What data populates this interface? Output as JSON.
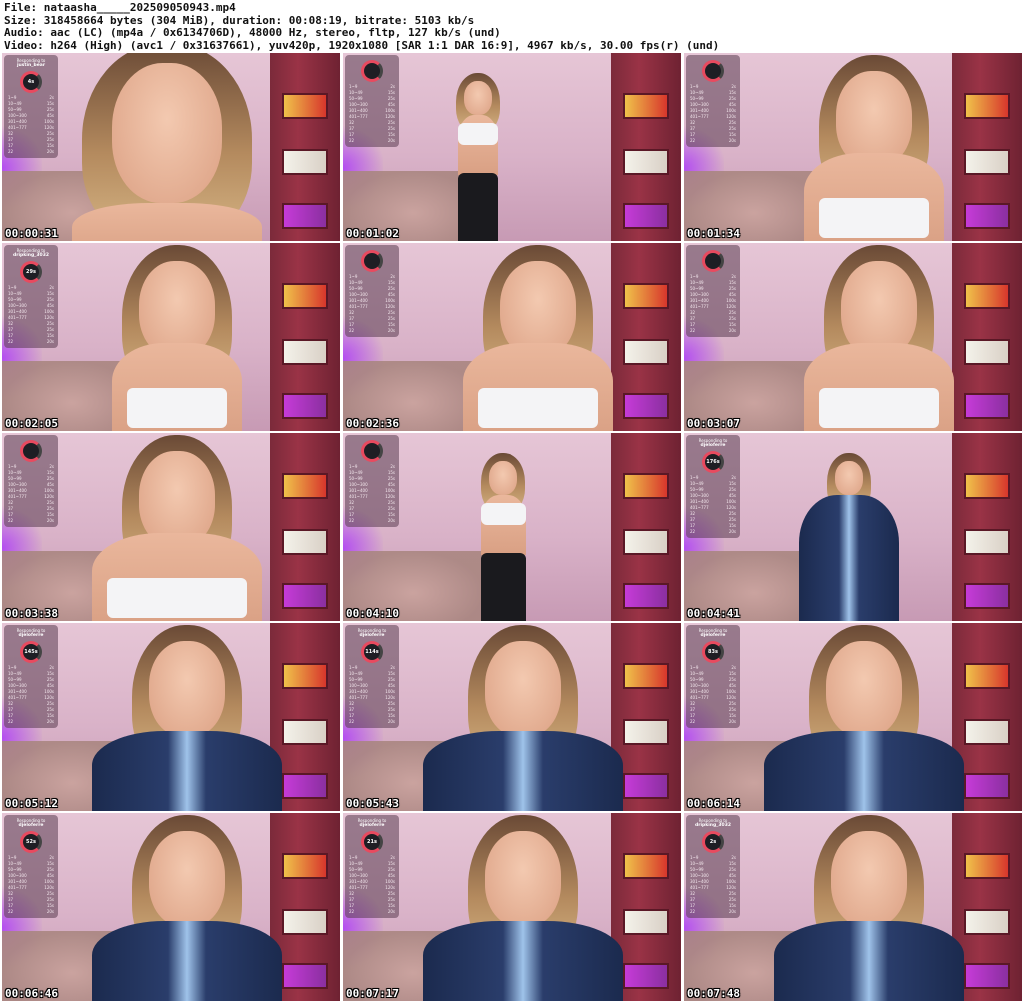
{
  "header": {
    "file": "File: nataasha_____202509050943.mp4",
    "size": "Size: 318458664 bytes (304 MiB), duration: 00:08:19, bitrate: 5103 kb/s",
    "audio": "Audio: aac (LC) (mp4a / 0x6134706D), 48000 Hz, stereo, fltp, 127 kb/s (und)",
    "video": "Video: h264 (High) (avc1 / 0x31637661), yuv420p, 1920x1080 [SAR 1:1 DAR 16:9], 4967 kb/s, 30.00 fps(r) (und)"
  },
  "thumbnails": [
    {
      "time": "00:00:31",
      "overlay": {
        "label": "Responding to",
        "user": "justin_bear",
        "ring": "4s"
      }
    },
    {
      "time": "00:01:02",
      "overlay": {
        "label": "",
        "user": "",
        "ring": ""
      }
    },
    {
      "time": "00:01:34",
      "overlay": {
        "label": "",
        "user": "",
        "ring": ""
      }
    },
    {
      "time": "00:02:05",
      "overlay": {
        "label": "Responding to",
        "user": "dripking_3032",
        "ring": "29s"
      }
    },
    {
      "time": "00:02:36",
      "overlay": {
        "label": "",
        "user": "",
        "ring": ""
      }
    },
    {
      "time": "00:03:07",
      "overlay": {
        "label": "",
        "user": "",
        "ring": ""
      }
    },
    {
      "time": "00:03:38",
      "overlay": {
        "label": "",
        "user": "",
        "ring": ""
      }
    },
    {
      "time": "00:04:10",
      "overlay": {
        "label": "",
        "user": "",
        "ring": ""
      }
    },
    {
      "time": "00:04:41",
      "overlay": {
        "label": "Responding to",
        "user": "djeloferre",
        "ring": "176s"
      }
    },
    {
      "time": "00:05:12",
      "overlay": {
        "label": "Responding to",
        "user": "djeloferre",
        "ring": "145s"
      }
    },
    {
      "time": "00:05:43",
      "overlay": {
        "label": "Responding to",
        "user": "djeloferre",
        "ring": "114s"
      }
    },
    {
      "time": "00:06:14",
      "overlay": {
        "label": "Responding to",
        "user": "djeloferre",
        "ring": "83s"
      }
    },
    {
      "time": "00:06:46",
      "overlay": {
        "label": "Responding to",
        "user": "djeloferre",
        "ring": "52s"
      }
    },
    {
      "time": "00:07:17",
      "overlay": {
        "label": "Responding to",
        "user": "djeloferre",
        "ring": "21s"
      }
    },
    {
      "time": "00:07:48",
      "overlay": {
        "label": "Responding to",
        "user": "dripking_3032",
        "ring": "2s"
      }
    }
  ],
  "menu_rows": [
    {
      "k": "1~9",
      "v": "2s"
    },
    {
      "k": "10~49",
      "v": "15s"
    },
    {
      "k": "50~99",
      "v": "25s"
    },
    {
      "k": "100~300",
      "v": "45s"
    },
    {
      "k": "301~400",
      "v": "100s"
    },
    {
      "k": "401~777",
      "v": "120s"
    },
    {
      "k": "32",
      "v": "25s"
    },
    {
      "k": "37",
      "v": "25s"
    },
    {
      "k": "17",
      "v": "15s"
    },
    {
      "k": "22",
      "v": "20s"
    }
  ],
  "colors": {
    "overlay_ring": "#e84a5f",
    "wall": "#e6c6d6",
    "door": "#7b2a3a"
  }
}
